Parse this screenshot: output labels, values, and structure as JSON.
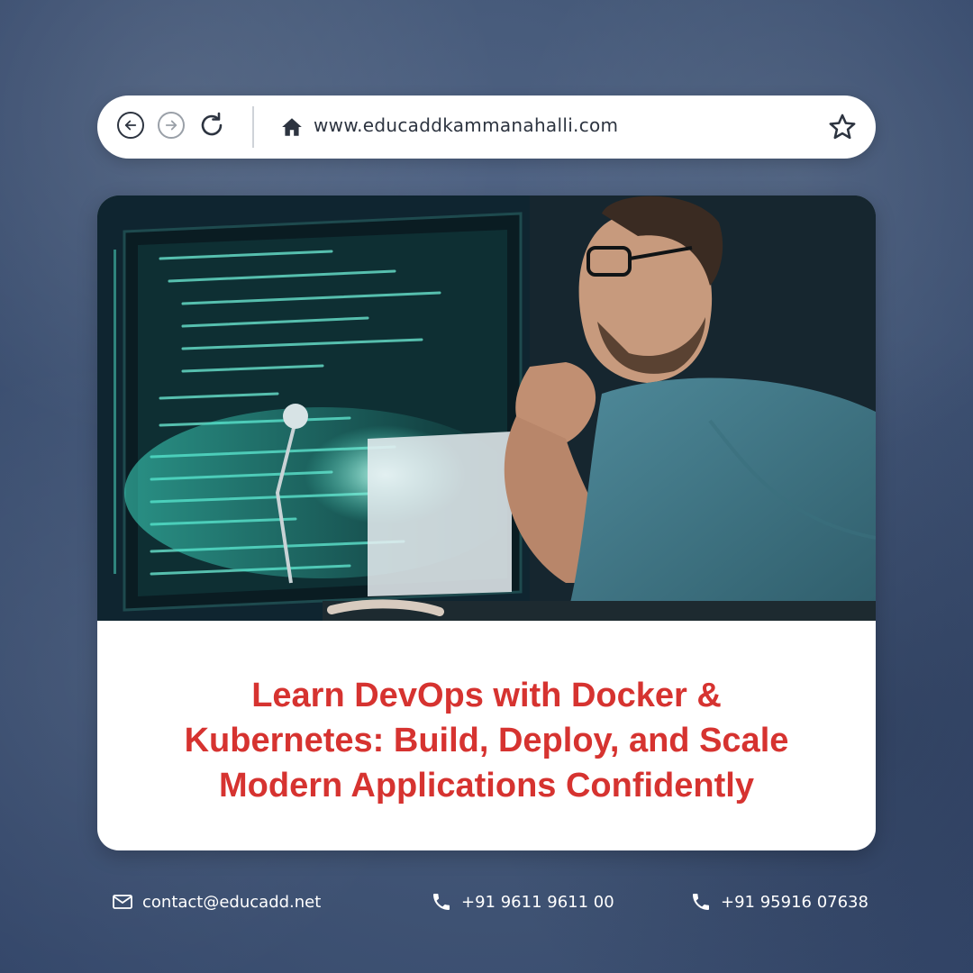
{
  "browser": {
    "url": "www.educaddkammanahalli.com",
    "icons": [
      "back-icon",
      "forward-icon",
      "reload-icon",
      "home-icon",
      "star-icon"
    ]
  },
  "card": {
    "title_lines": [
      "Learn DevOps with Docker &",
      "Kubernetes: Build, Deploy, and Scale",
      "Modern Applications Confidently"
    ]
  },
  "footer": {
    "email": "contact@educadd.net",
    "phone1": "+91 9611 9611 00",
    "phone2": "+91 95916 07638"
  },
  "colors": {
    "title": "#d63330",
    "background": "#445878",
    "card": "#ffffff"
  }
}
